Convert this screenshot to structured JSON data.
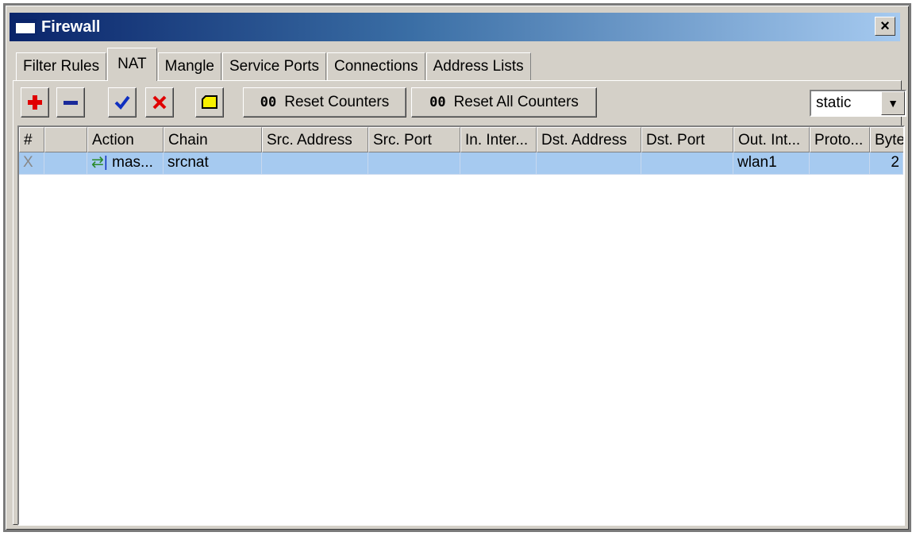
{
  "window": {
    "title": "Firewall",
    "close_label": "×"
  },
  "tabs": [
    {
      "label": "Filter Rules"
    },
    {
      "label": "NAT",
      "active": true
    },
    {
      "label": "Mangle"
    },
    {
      "label": "Service Ports"
    },
    {
      "label": "Connections"
    },
    {
      "label": "Address Lists"
    }
  ],
  "toolbar": {
    "reset_counters": {
      "prefix": "00",
      "label": "Reset Counters"
    },
    "reset_all_counters": {
      "prefix": "00",
      "label": "Reset All Counters"
    },
    "filter_select": {
      "value": "static"
    }
  },
  "table": {
    "columns": [
      "#",
      "",
      "Action",
      "Chain",
      "Src. Address",
      "Src. Port",
      "In. Inter...",
      "Dst. Address",
      "Dst. Port",
      "Out. Int...",
      "Proto...",
      "Byte"
    ],
    "rows": [
      {
        "num": "X",
        "flag": "",
        "action": "mas...",
        "chain": "srcnat",
        "src_address": "",
        "src_port": "",
        "in_interface": "",
        "dst_address": "",
        "dst_port": "",
        "out_interface": "wlan1",
        "protocol": "",
        "bytes": "2"
      }
    ]
  },
  "colors": {
    "title_start": "#0a246a",
    "title_end": "#a6caf0",
    "selected_row": "#a6caf0",
    "add_icon": "#e00000",
    "remove_icon": "#1a2a9a",
    "enable_icon": "#1030c0",
    "disable_icon": "#e00000"
  }
}
